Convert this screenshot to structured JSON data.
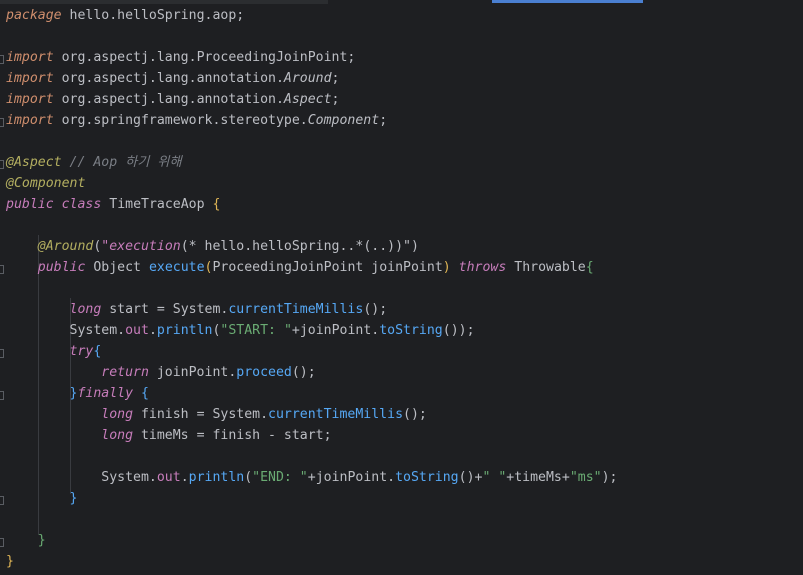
{
  "package_kw": "package",
  "package_name": "hello.helloSpring.aop;",
  "imports": [
    {
      "kw": "import",
      "path": "org.aspectj.lang.ProceedingJoinPoint;",
      "italic": ""
    },
    {
      "kw": "import",
      "path": "org.aspectj.lang.annotation.",
      "italic": "Around",
      "end": ";"
    },
    {
      "kw": "import",
      "path": "org.aspectj.lang.annotation.",
      "italic": "Aspect",
      "end": ";"
    },
    {
      "kw": "import",
      "path": "org.springframework.stereotype.",
      "italic": "Component",
      "end": ";"
    }
  ],
  "annotations": {
    "aspect": "@Aspect",
    "aspect_comment": "// Aop 하기 위해",
    "component": "@Component"
  },
  "class_decl": {
    "kw1": "public",
    "kw2": "class",
    "name": "TimeTraceAop",
    "brace": "{"
  },
  "around": {
    "ann": "@Around",
    "open": "(",
    "expr": "\"execution",
    "expr_rest": "(* hello.helloSpring..*(..))\"",
    "close": ")"
  },
  "method": {
    "kw": "public",
    "ret": "Object",
    "name": "execute",
    "open": "(",
    "ptype": "ProceedingJoinPoint",
    "pname": "joinPoint",
    "close": ")",
    "throws": "throws",
    "exc": "Throwable",
    "brace": "{"
  },
  "body": {
    "l1": {
      "type": "long",
      "var": " start = System.",
      "call": "currentTimeMillis",
      "end": "();"
    },
    "l2": {
      "sys": "System.",
      "fld": "out",
      "dot": ".",
      "call": "println",
      "str": "\"START: \"",
      "mid": "+joinPoint.",
      "call2": "toString",
      "end": "());"
    },
    "try_kw": "try",
    "try_brace": "{",
    "ret_kw": "return",
    "ret_rest": " joinPoint.",
    "ret_call": "proceed",
    "ret_end": "();",
    "finally_close": "}",
    "finally_kw": "finally",
    "finally_brace": "{",
    "f1": {
      "type": "long",
      "var": " finish = System.",
      "call": "currentTimeMillis",
      "end": "();"
    },
    "f2": {
      "type": "long",
      "rest": " timeMs = finish - start;"
    },
    "f3": {
      "sys": "System.",
      "fld": "out",
      "dot": ".",
      "call": "println",
      "str": "\"END: \"",
      "mid": "+joinPoint.",
      "call2": "toString",
      "mid2": "()+",
      "str2": "\" \"",
      "mid3": "+timeMs+",
      "str3": "\"ms\"",
      "end": ");"
    },
    "finally_end": "}",
    "method_end": "}",
    "class_end": "}"
  },
  "colors": {
    "background": "#1e1f22",
    "keyword": "#cf8e6d",
    "annotation": "#b3ae60",
    "string": "#6aab73",
    "method": "#56a8f5",
    "field": "#c77dbb",
    "comment": "#7a7e85"
  }
}
